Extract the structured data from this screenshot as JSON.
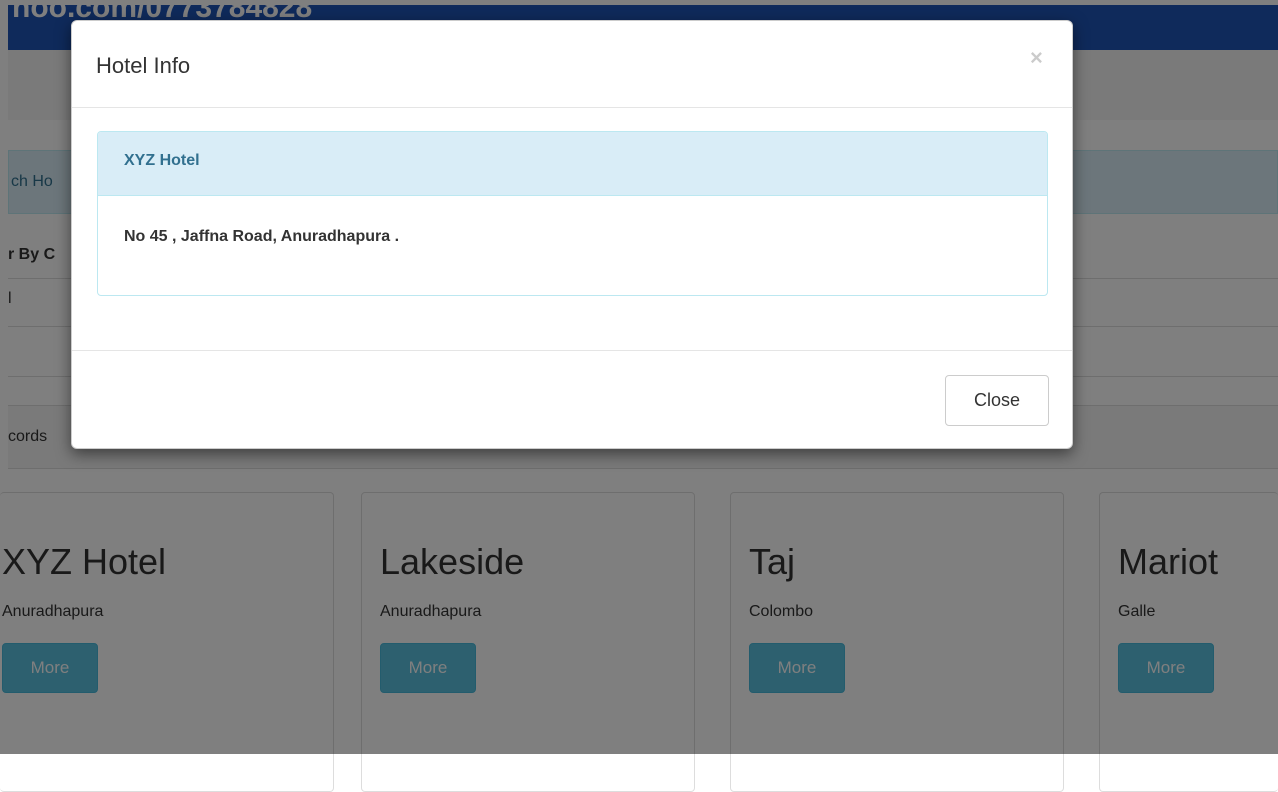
{
  "page": {
    "brand_text": "hoo.com/0773784828",
    "search_text": "ch Ho",
    "filter_heading": "r By C",
    "filter_field_text": "l",
    "records_text": "cords"
  },
  "cards": [
    {
      "title": "XYZ Hotel",
      "city": "Anuradhapura",
      "button": "More"
    },
    {
      "title": "Lakeside",
      "city": "Anuradhapura",
      "button": "More"
    },
    {
      "title": "Taj",
      "city": "Colombo",
      "button": "More"
    },
    {
      "title": "Mariot",
      "city": "Galle",
      "button": "More"
    }
  ],
  "modal": {
    "title": "Hotel Info",
    "close_icon": "×",
    "panel_title": "XYZ Hotel",
    "panel_body": "No 45 , Jaffna Road, Anuradhapura .",
    "close_button": "Close"
  },
  "colors": {
    "brand": "#1e54b7",
    "info_bg": "#d9edf7",
    "info_text": "#31708f",
    "button_info": "#5bc0de"
  }
}
